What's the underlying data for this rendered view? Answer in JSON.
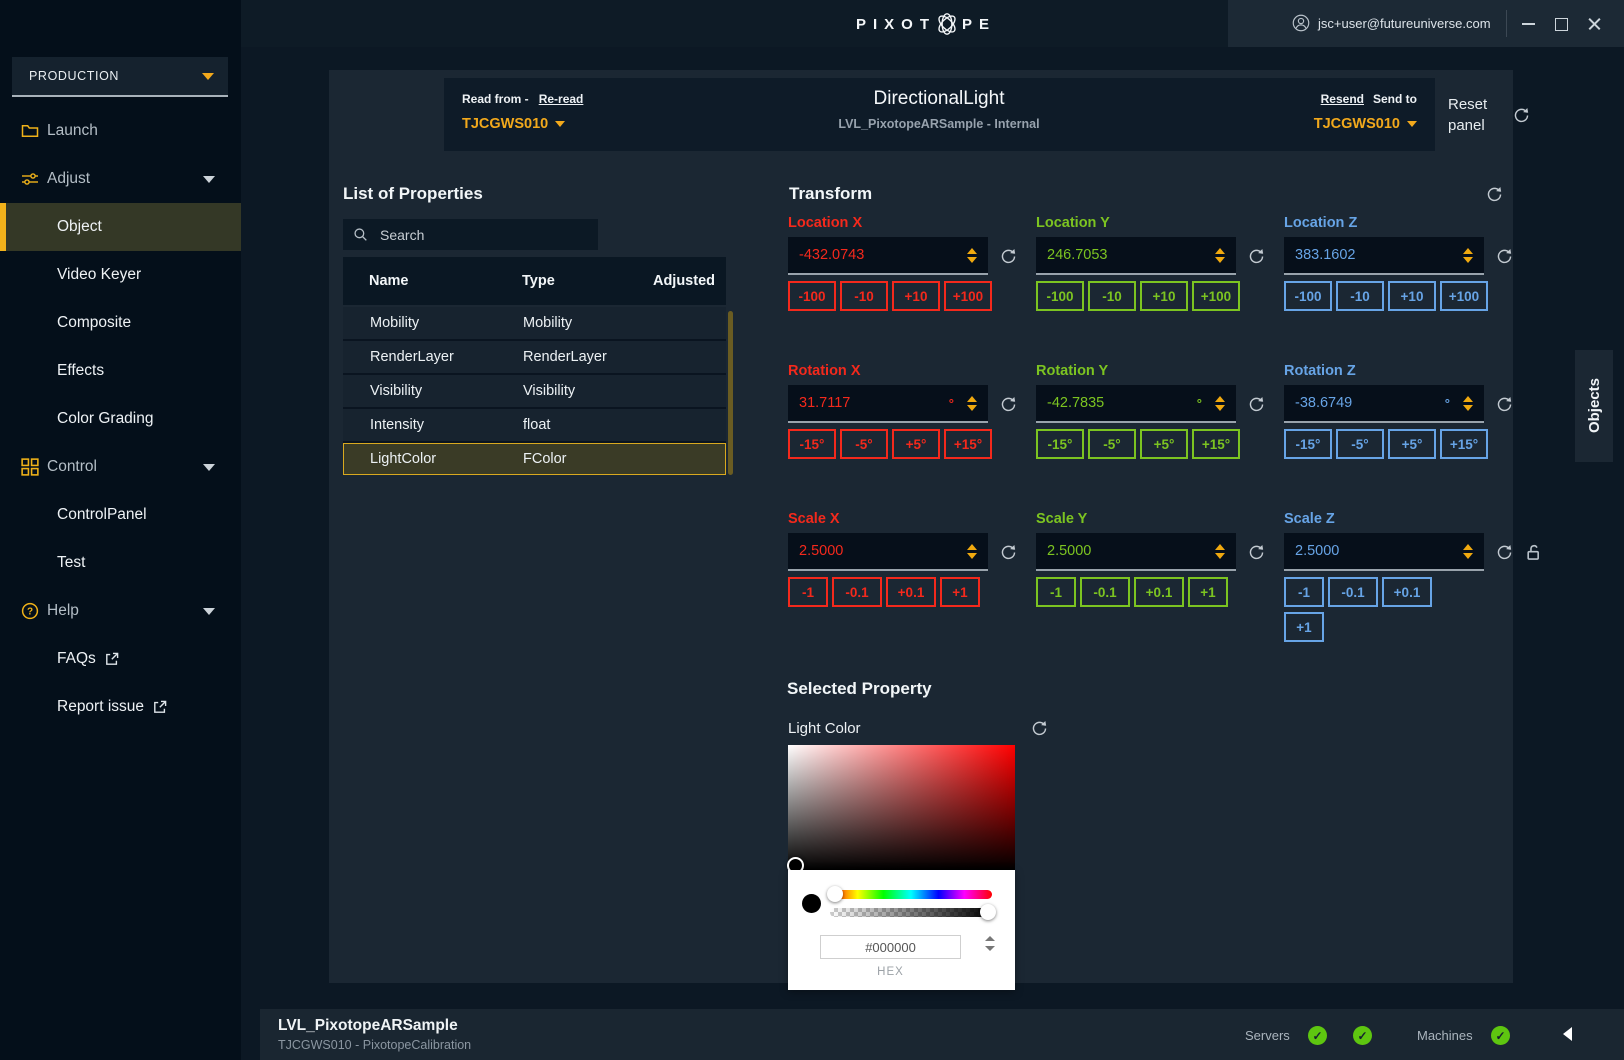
{
  "topbar": {
    "logo_part1": "PIXOT",
    "logo_part2": "PE",
    "user_email": "jsc+user@futureuniverse.com"
  },
  "sidebar": {
    "production_label": "PRODUCTION",
    "items": [
      {
        "label": "Launch",
        "level": "section",
        "icon": "folder-icon"
      },
      {
        "label": "Adjust",
        "level": "section",
        "icon": "sliders-icon",
        "expanded": true
      },
      {
        "label": "Object",
        "level": "sub",
        "selected": true
      },
      {
        "label": "Video Keyer",
        "level": "sub"
      },
      {
        "label": "Composite",
        "level": "sub"
      },
      {
        "label": "Effects",
        "level": "sub"
      },
      {
        "label": "Color Grading",
        "level": "sub"
      },
      {
        "label": "Control",
        "level": "section",
        "icon": "grid-icon",
        "expanded": true
      },
      {
        "label": "ControlPanel",
        "level": "sub"
      },
      {
        "label": "Test",
        "level": "sub"
      },
      {
        "label": "Help",
        "level": "section",
        "icon": "help-icon",
        "expanded": true
      },
      {
        "label": "FAQs",
        "level": "sub",
        "external": true
      },
      {
        "label": "Report issue",
        "level": "sub",
        "external": true
      }
    ]
  },
  "header": {
    "read_from_label": "Read from -",
    "reread_link": "Re-read",
    "read_from_machine": "TJCGWS010",
    "title": "DirectionalLight",
    "subtitle": "LVL_PixotopeARSample - Internal",
    "resend_link": "Resend",
    "send_to_label": "Send to",
    "send_to_machine": "TJCGWS010",
    "reset_panel_label": "Reset panel"
  },
  "properties": {
    "heading": "List of Properties",
    "search_placeholder": "Search",
    "columns": [
      "Name",
      "Type",
      "Adjusted"
    ],
    "rows": [
      {
        "name": "Mobility",
        "type": "Mobility",
        "adjusted": "",
        "selected": false
      },
      {
        "name": "RenderLayer",
        "type": "RenderLayer",
        "adjusted": "",
        "selected": false
      },
      {
        "name": "Visibility",
        "type": "Visibility",
        "adjusted": "",
        "selected": false
      },
      {
        "name": "Intensity",
        "type": "float",
        "adjusted": "",
        "selected": false
      },
      {
        "name": "LightColor",
        "type": "FColor",
        "adjusted": "",
        "selected": true
      }
    ]
  },
  "transform": {
    "heading": "Transform",
    "groups": [
      {
        "label": "Location X",
        "axis": "x",
        "value": "-432.0743",
        "unit": "",
        "buttons": [
          "-100",
          "-10",
          "+10",
          "+100"
        ]
      },
      {
        "label": "Location Y",
        "axis": "y",
        "value": "246.7053",
        "unit": "",
        "buttons": [
          "-100",
          "-10",
          "+10",
          "+100"
        ]
      },
      {
        "label": "Location Z",
        "axis": "z",
        "value": "383.1602",
        "unit": "",
        "buttons": [
          "-100",
          "-10",
          "+10",
          "+100"
        ]
      },
      {
        "label": "Rotation X",
        "axis": "x",
        "value": "31.7117",
        "unit": "°",
        "buttons": [
          "-15°",
          "-5°",
          "+5°",
          "+15°"
        ]
      },
      {
        "label": "Rotation Y",
        "axis": "y",
        "value": "-42.7835",
        "unit": "°",
        "buttons": [
          "-15°",
          "-5°",
          "+5°",
          "+15°"
        ]
      },
      {
        "label": "Rotation Z",
        "axis": "z",
        "value": "-38.6749",
        "unit": "°",
        "buttons": [
          "-15°",
          "-5°",
          "+5°",
          "+15°"
        ]
      },
      {
        "label": "Scale X",
        "axis": "x",
        "value": "2.5000",
        "unit": "",
        "buttons": [
          "-1",
          "-0.1",
          "+0.1",
          "+1"
        ]
      },
      {
        "label": "Scale Y",
        "axis": "y",
        "value": "2.5000",
        "unit": "",
        "buttons": [
          "-1",
          "-0.1",
          "+0.1",
          "+1"
        ]
      },
      {
        "label": "Scale Z",
        "axis": "z",
        "value": "2.5000",
        "unit": "",
        "buttons": [
          "-1",
          "-0.1",
          "+0.1",
          "+1"
        ],
        "lock": true
      }
    ]
  },
  "selected_property": {
    "heading": "Selected Property",
    "property_label": "Light Color",
    "hex_value": "#000000",
    "hex_label": "HEX"
  },
  "objects_tab_label": "Objects",
  "statusbar": {
    "level_name": "LVL_PixotopeARSample",
    "machine_info": "TJCGWS010 - PixotopeCalibration",
    "servers_label": "Servers",
    "machines_label": "Machines"
  },
  "colors": {
    "accent_gold": "#f2a91c",
    "axis_x_red": "#f4291c",
    "axis_y_green": "#7cc421",
    "axis_z_blue": "#67a4e6",
    "status_ok_green": "#5ec610",
    "panel_bg": "#1b2733",
    "sidebar_bg": "#040f1a"
  }
}
